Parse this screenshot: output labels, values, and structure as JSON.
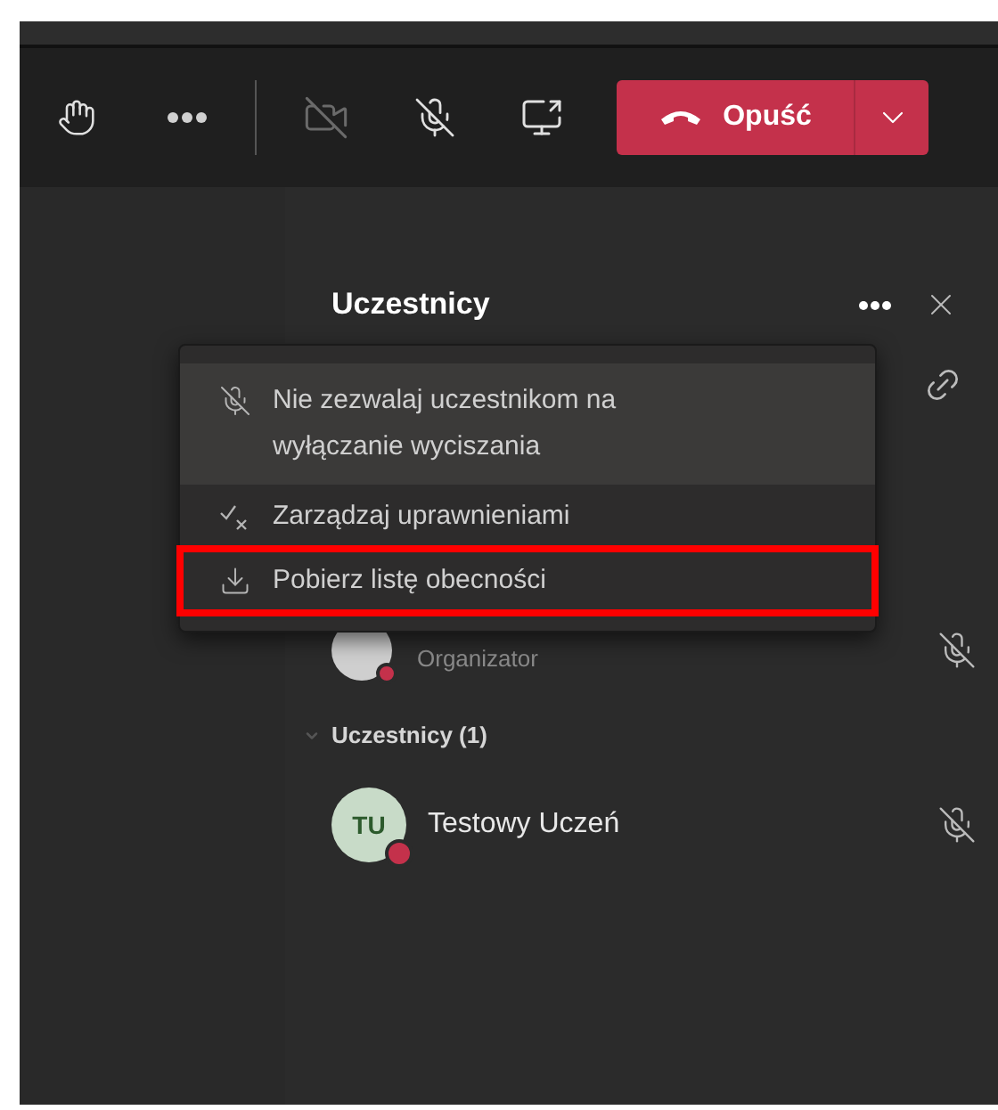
{
  "toolbar": {
    "camera_on": false,
    "mic_on": false,
    "leave_label": "Opuść"
  },
  "panel": {
    "title": "Uczestnicy",
    "menu": [
      {
        "kind": "mic-lock",
        "label": "Nie zezwalaj uczestnikom na wyłączanie wyciszania",
        "selected": true,
        "annotated": false
      },
      {
        "kind": "permissions",
        "label": "Zarządzaj uprawnieniami",
        "selected": false,
        "annotated": false
      },
      {
        "kind": "download",
        "label": "Pobierz listę obecności",
        "selected": false,
        "annotated": true
      }
    ],
    "organizer": {
      "role": "Organizator",
      "mic_on": false
    },
    "section": {
      "label": "Uczestnicy (1)",
      "expanded": true
    },
    "participants": [
      {
        "initials": "TU",
        "name": "Testowy Uczeń",
        "mic_on": false
      }
    ]
  }
}
